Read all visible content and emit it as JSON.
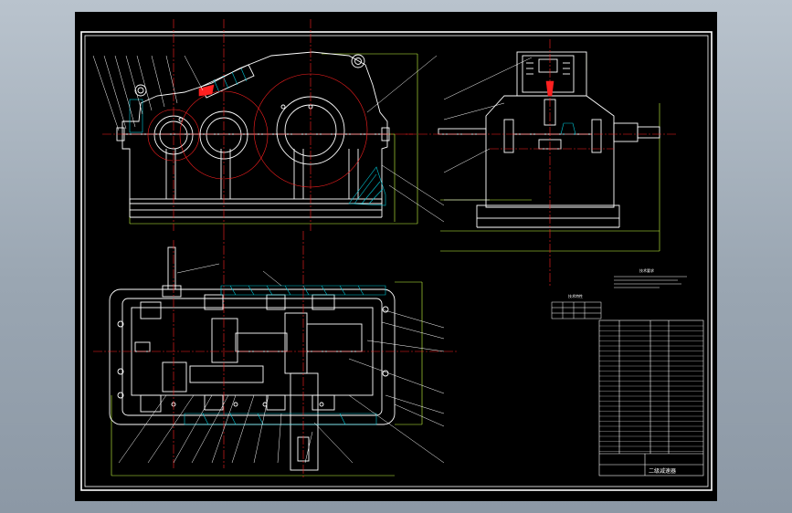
{
  "viewer": {
    "background": "#000000"
  },
  "colors": {
    "part_outline": "#ffffff",
    "center_lines": "#ff2020",
    "section_hatch": "#00c8d8",
    "dimension_lines": "#c8ff40",
    "leader_lines": "#ffffff",
    "highlight": "#ff2020",
    "frame": "#ffffff"
  },
  "views": [
    {
      "name": "front-view"
    },
    {
      "name": "side-view"
    },
    {
      "name": "top-section-view"
    }
  ],
  "notes": {
    "heading": "技术要求",
    "table_heading": "技术特性"
  },
  "title_block": {
    "title": "二级减速器"
  }
}
